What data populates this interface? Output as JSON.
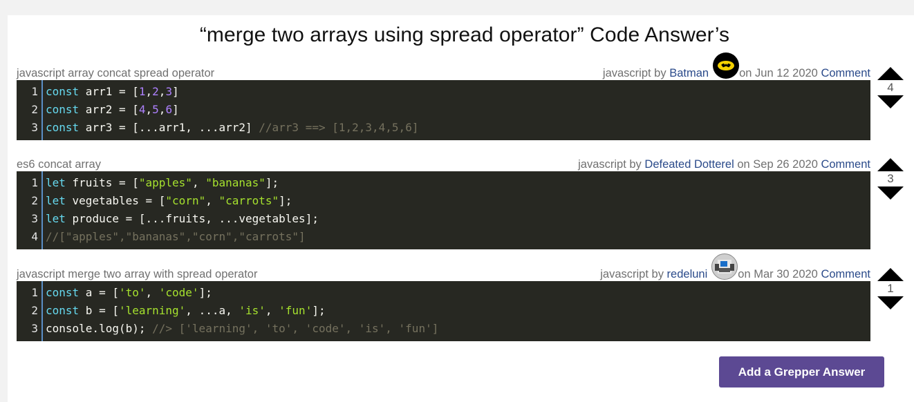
{
  "title": "“merge two arrays using spread operator” Code Answer’s",
  "by_text": "javascript by",
  "on_text": "on",
  "answers": [
    {
      "heading": "javascript array concat spread operator",
      "author": "Batman",
      "date": "Jun 12 2020",
      "comment_label": "Comment",
      "votes": "4",
      "avatar": "batman-avatar",
      "lines": [
        {
          "n": "1",
          "code": "const arr1 = [1,2,3]"
        },
        {
          "n": "2",
          "code": "const arr2 = [4,5,6]"
        },
        {
          "n": "3",
          "code": "const arr3 = [...arr1, ...arr2] //arr3 ==> [1,2,3,4,5,6]"
        }
      ]
    },
    {
      "heading": "es6 concat array",
      "author": "Defeated Dotterel",
      "date": "Sep 26 2020",
      "comment_label": "Comment",
      "votes": "3",
      "avatar": "",
      "lines": [
        {
          "n": "1",
          "code": "let fruits = [\"apples\", \"bananas\"];"
        },
        {
          "n": "2",
          "code": "let vegetables = [\"corn\", \"carrots\"];"
        },
        {
          "n": "3",
          "code": "let produce = [...fruits, ...vegetables];"
        },
        {
          "n": "4",
          "code": "//[\"apples\",\"bananas\",\"corn\",\"carrots\"]"
        }
      ]
    },
    {
      "heading": "javascript merge two array with spread operator",
      "author": "redeluni",
      "date": "Mar 30 2020",
      "comment_label": "Comment",
      "votes": "1",
      "avatar": "pixel-avatar",
      "lines": [
        {
          "n": "1",
          "code": "const a = ['to', 'code'];"
        },
        {
          "n": "2",
          "code": "const b = ['learning', ...a, 'is', 'fun'];"
        },
        {
          "n": "3",
          "code": "console.log(b); //> ['learning', 'to', 'code', 'is', 'fun']"
        }
      ]
    }
  ],
  "add_answer_label": "Add a Grepper Answer",
  "colors": {
    "code_bg": "#272822",
    "keyword": "#66d9ef",
    "number": "#ae81ff",
    "string": "#a6e22e",
    "comment": "#75715e",
    "link": "#2a4a8a",
    "button": "#5c4993"
  }
}
